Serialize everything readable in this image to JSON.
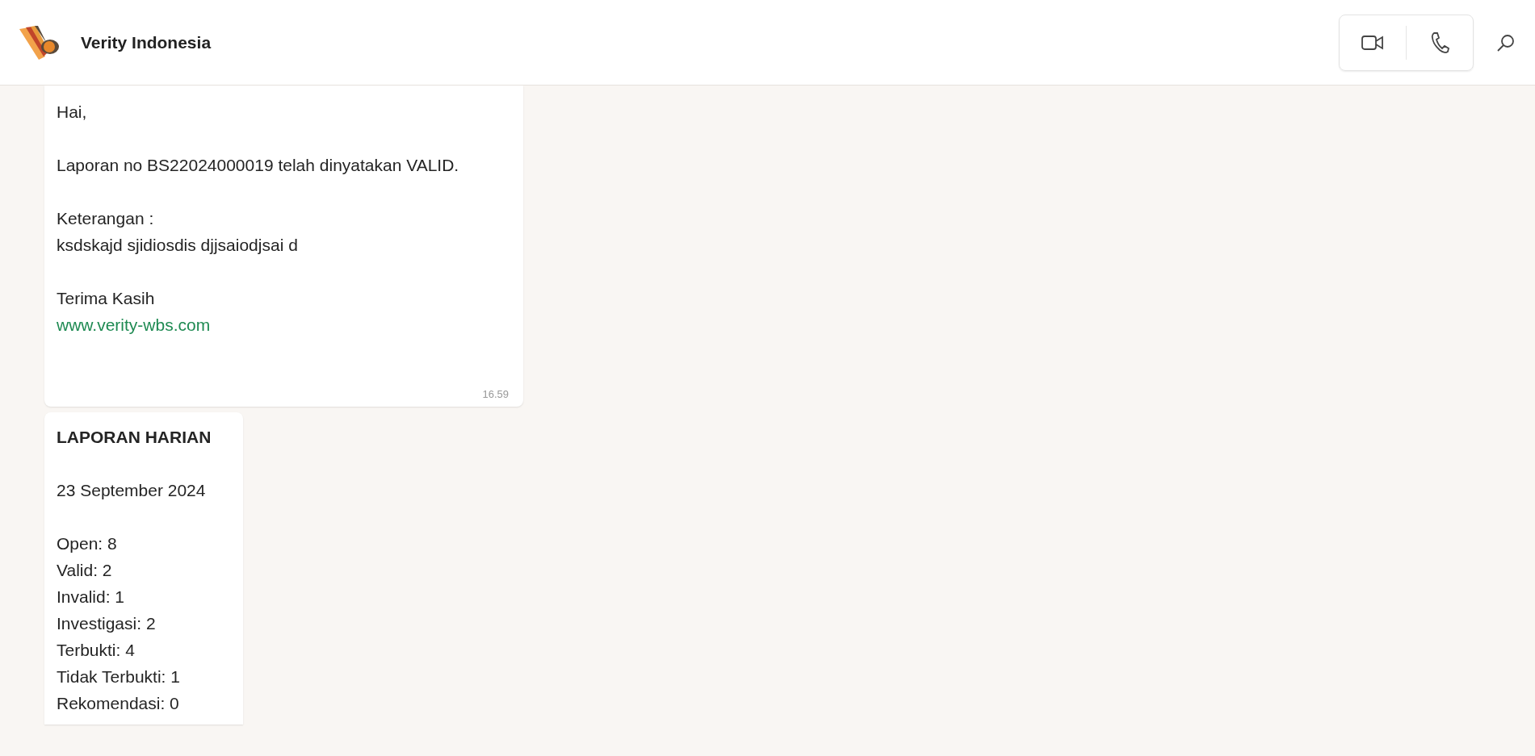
{
  "header": {
    "title": "Verity Indonesia"
  },
  "messages": [
    {
      "paragraphs": [
        [
          {
            "kind": "text",
            "text": "Hai,"
          }
        ],
        [
          {
            "kind": "text",
            "text": "Laporan no BS22024000019 telah dinyatakan VALID."
          }
        ],
        [
          {
            "kind": "text",
            "text": "Keterangan :"
          },
          {
            "kind": "text",
            "text": "ksdskajd sjidiosdis djjsaiodjsai d"
          }
        ],
        [
          {
            "kind": "text",
            "text": "Terima Kasih"
          },
          {
            "kind": "link",
            "text": "www.verity-wbs.com"
          }
        ]
      ],
      "time": "16.59"
    },
    {
      "paragraphs": [
        [
          {
            "kind": "heading",
            "text": "LAPORAN HARIAN"
          }
        ],
        [
          {
            "kind": "text",
            "text": "23 September 2024"
          }
        ],
        [
          {
            "kind": "text",
            "text": "Open: 8"
          },
          {
            "kind": "text",
            "text": "Valid: 2"
          },
          {
            "kind": "text",
            "text": "Invalid: 1"
          },
          {
            "kind": "text",
            "text": "Investigasi: 2"
          },
          {
            "kind": "text",
            "text": "Terbukti: 4"
          },
          {
            "kind": "text",
            "text": "Tidak Terbukti: 1"
          },
          {
            "kind": "text",
            "text": "Rekomendasi: 0"
          }
        ]
      ]
    }
  ]
}
